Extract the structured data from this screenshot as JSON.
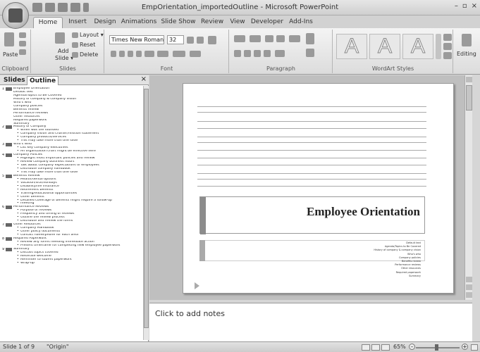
{
  "window": {
    "title": "EmpOrientation_importedOutline - Microsoft PowerPoint",
    "controls": [
      "–",
      "▫",
      "×"
    ]
  },
  "tabs": [
    "Home",
    "Insert",
    "Design",
    "Animations",
    "Slide Show",
    "Review",
    "View",
    "Developer",
    "Add-Ins"
  ],
  "ribbon": {
    "clipboard": {
      "label": "Clipboard",
      "paste": "Paste"
    },
    "slides": {
      "label": "Slides",
      "add": "Add",
      "add2": "Slide ▾",
      "layout": "Layout ▾",
      "reset": "Reset",
      "delete": "Delete"
    },
    "font": {
      "label": "Font",
      "name": "Times New Roman",
      "size": "32"
    },
    "paragraph": {
      "label": "Paragraph"
    },
    "wordart": {
      "label": "WordArt Styles",
      "letter": "A"
    },
    "editing": {
      "label": "Editing"
    }
  },
  "pane": {
    "tab_slides": "Slides",
    "tab_outline": "Outline",
    "close": "×"
  },
  "outline": [
    {
      "n": "1",
      "title": "Employee Orientation",
      "l1": [
        "Default text",
        "Agenda/Topics to Be Covered",
        "History of company & company vision",
        "Who's who",
        "Company policies",
        "Benefits review",
        "Performance reviews",
        "Other resources",
        "Required paperwork",
        "Summary"
      ],
      "l2": []
    },
    {
      "n": "2",
      "title": "History of Company",
      "l1": [],
      "l2": [
        "When was the founded",
        "Company vision and charter/mission statement",
        "Company products/services",
        "This may take more than one slide"
      ]
    },
    {
      "n": "3",
      "title": "Who's Who",
      "l1": [],
      "l2": [
        "List key company executives",
        "An organization chart might be effective here"
      ]
    },
    {
      "n": "4",
      "title": "Company Policies",
      "l1": [],
      "l2": [
        "Highlight most important policies and review",
        "Review company business hours",
        "Talk about company expectations of employees",
        "Distribute company handbook",
        "This may take more than one slide"
      ]
    },
    {
      "n": "5",
      "title": "Benefits Review",
      "l1": [],
      "l2": [
        "Health/dental options",
        "Vacation/sick/holidays",
        "Disability/life insurance",
        "Retirement benefits",
        "Training/educational opportunities",
        "Other benefits",
        "Detailed coverage of benefits might require a follow-up",
        "meeting"
      ]
    },
    {
      "n": "6",
      "title": "Performance Reviews",
      "l1": [],
      "l2": [
        "Purpose of reviews",
        "Frequency and timing of reviews",
        "Outline the review process",
        "Distribute and review the forms"
      ]
    },
    {
      "n": "7",
      "title": "Other Resources",
      "l1": [],
      "l2": [
        "Company Handbook",
        "Other policy documents",
        "Contact name/phone for each area"
      ]
    },
    {
      "n": "8",
      "title": "Required Paperwork",
      "l1": [],
      "l2": [
        "Review any forms needing immediate action",
        "Present timeframe for completing new employee paperwork"
      ]
    },
    {
      "n": "9",
      "title": "Summary",
      "l1": [],
      "l2": [
        "Discuss topics covered",
        "Reiterate welcome",
        "Reminder to submit paperwork",
        "Wrap-up"
      ]
    }
  ],
  "slide": {
    "title": "Employee Orientation",
    "subtitle": [
      "Default text",
      "Agenda/Topics to Be Covered",
      "History of company & company vision",
      "Who's who",
      "Company policies",
      "Benefits review",
      "Performance reviews",
      "Other resources",
      "Required paperwork",
      "Summary"
    ]
  },
  "notes": {
    "placeholder": "Click to add notes"
  },
  "status": {
    "slide": "Slide 1 of 9",
    "theme": "\"Origin\"",
    "zoom": "65%",
    "minus": "–",
    "plus": "+"
  }
}
